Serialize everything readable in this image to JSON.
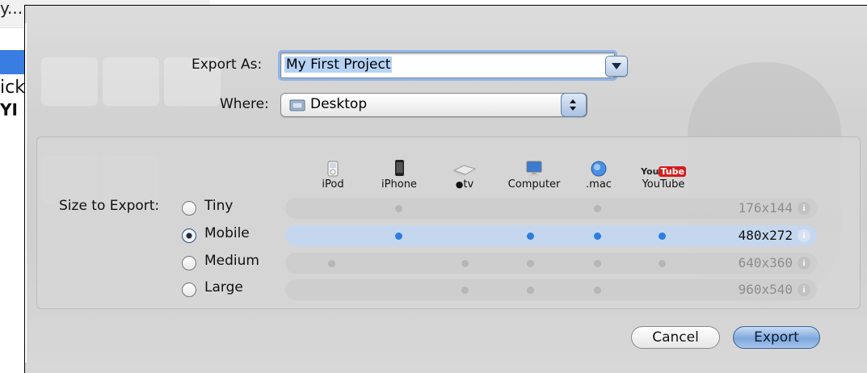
{
  "background": {
    "menu_text": "y...",
    "line1": "ick",
    "line2": "YI"
  },
  "dialog": {
    "export_as_label": "Export As:",
    "export_as_value": "My First Project",
    "where_label": "Where:",
    "where_value": "Desktop",
    "size_to_export_label": "Size to Export:",
    "devices": [
      {
        "name": "iPod",
        "icon": "ipod-icon"
      },
      {
        "name": "iPhone",
        "icon": "iphone-icon"
      },
      {
        "name": "tv",
        "icon": "apple-tv-icon"
      },
      {
        "name": "Computer",
        "icon": "computer-icon"
      },
      {
        "name": ".mac",
        "icon": "dotmac-icon"
      },
      {
        "name": "YouTube",
        "icon": "youtube-icon",
        "logo_text_a": "You",
        "logo_text_b": "Tube"
      }
    ],
    "sizes": [
      {
        "label": "Tiny",
        "resolution": "176x144",
        "selected": false
      },
      {
        "label": "Mobile",
        "resolution": "480x272",
        "selected": true
      },
      {
        "label": "Medium",
        "resolution": "640x360",
        "selected": false
      },
      {
        "label": "Large",
        "resolution": "960x540",
        "selected": false
      }
    ],
    "info_glyph": "i",
    "cancel_label": "Cancel",
    "export_label": "Export",
    "colors": {
      "accent": "#2f7de0",
      "selected_row": "#c5d7ee",
      "focus_ring": "#8fb6ea"
    }
  }
}
